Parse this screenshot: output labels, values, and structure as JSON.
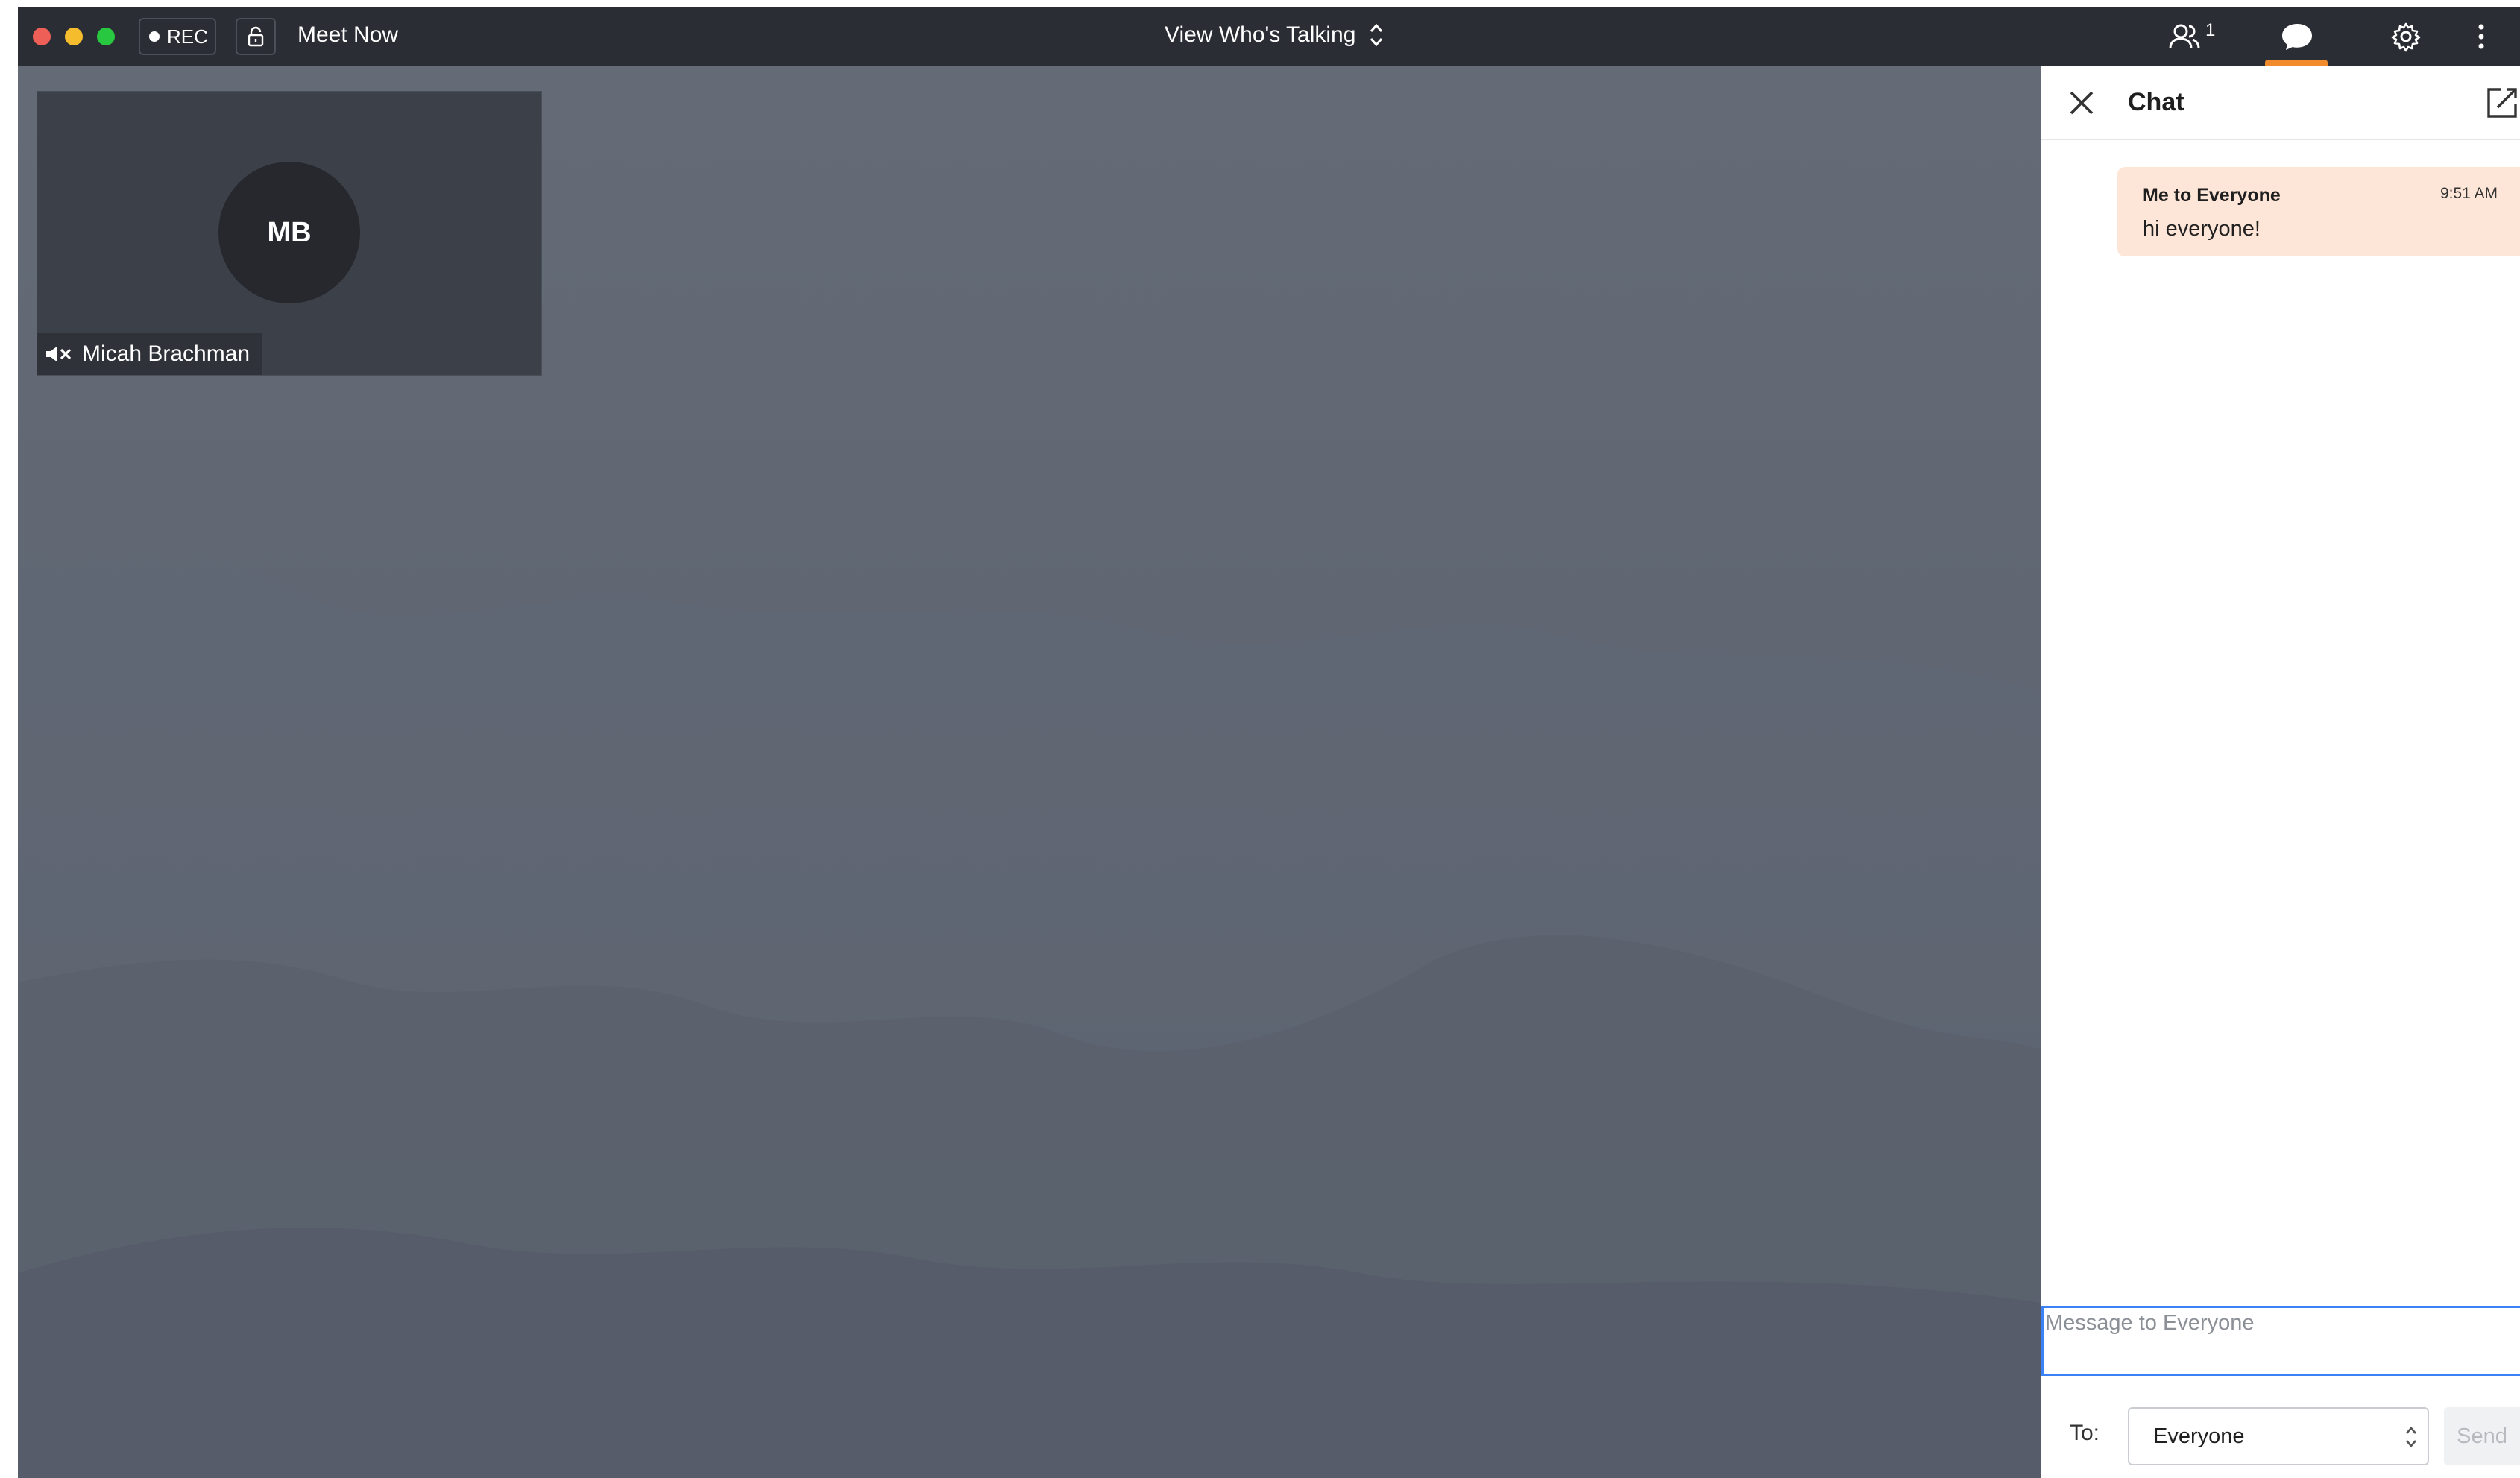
{
  "window": {
    "controls": [
      "close",
      "minimize",
      "maximize"
    ]
  },
  "toolbar": {
    "rec_label": "REC",
    "lock_icon": "lock-icon",
    "meeting_title": "Meet Now",
    "view_mode": "View Who's Talking",
    "participants_count": "1",
    "chat_active": true,
    "accent_color": "#f28b2c"
  },
  "stage": {
    "tile": {
      "initials": "MB",
      "name": "Micah Brachman",
      "muted": true
    }
  },
  "chat": {
    "title": "Chat",
    "messages": [
      {
        "sender": "Me to Everyone",
        "time": "9:51 AM",
        "text": "hi everyone!"
      }
    ],
    "input_placeholder": "Message to Everyone",
    "to_label": "To:",
    "recipient": "Everyone",
    "send_label": "Send",
    "bubble_color": "#fde6d7",
    "focus_color": "#3b82f6"
  }
}
